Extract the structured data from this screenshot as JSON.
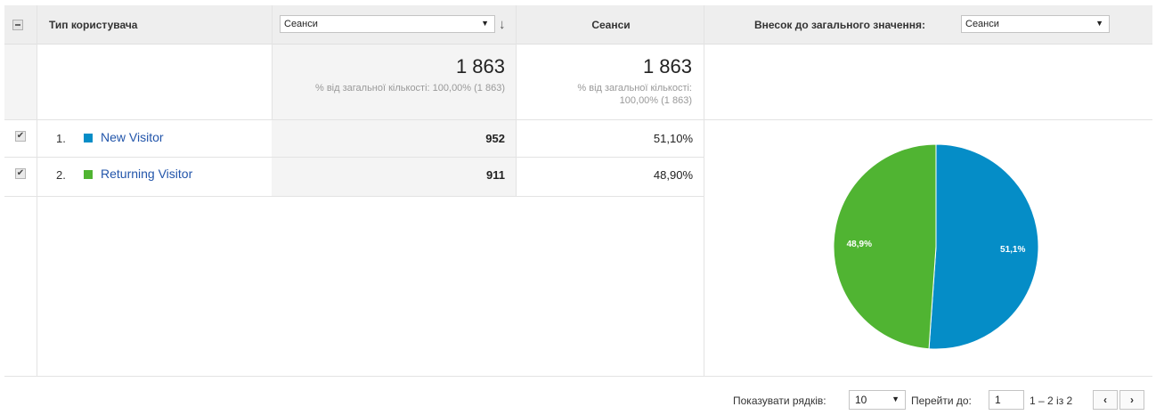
{
  "header": {
    "user_type_label": "Тип користувача",
    "metric_select_value": "Сеанси",
    "sessions_label": "Сеанси",
    "contribution_label": "Внесок до загального значення:",
    "contribution_select_value": "Сеанси"
  },
  "totals": {
    "selected_value": "1 863",
    "selected_note": "% від загальної кількості: 100,00% (1 863)",
    "sessions_value": "1 863",
    "sessions_note": "% від загальної кількості: 100,00% (1 863)"
  },
  "rows": [
    {
      "index": "1.",
      "label": "New Visitor",
      "color": "#058dc7",
      "value": "952",
      "percent": "51,10%",
      "checked": true
    },
    {
      "index": "2.",
      "label": "Returning Visitor",
      "color": "#50b432",
      "value": "911",
      "percent": "48,90%",
      "checked": true
    }
  ],
  "pie": {
    "slices": [
      {
        "label": "51,1%",
        "share": 51.1,
        "color": "#058dc7"
      },
      {
        "label": "48,9%",
        "share": 48.9,
        "color": "#50b432"
      }
    ]
  },
  "footer": {
    "rows_label": "Показувати рядків:",
    "rows_value": "10",
    "goto_label": "Перейти до:",
    "goto_value": "1",
    "range_label": "1 – 2 із 2",
    "prev_icon": "chevron-left-icon",
    "next_icon": "chevron-right-icon"
  }
}
